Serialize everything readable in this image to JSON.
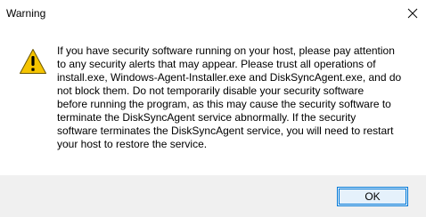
{
  "window": {
    "title": "Warning"
  },
  "titlebar": {
    "close_icon": "close-icon"
  },
  "message": {
    "icon": "warning-icon",
    "lines": [
      "If you have security software running on your host, please pay attention",
      "to any security alerts that may appear. Please trust all operations of",
      "install.exe, Windows-Agent-Installer.exe and DiskSyncAgent.exe, and do",
      "not block them. Do not temporarily disable your security software",
      "before running the program, as this may cause the security software to",
      "terminate the DiskSyncAgent service abnormally. If the security",
      "software terminates the DiskSyncAgent service, you will need to restart",
      "your host to restore the service."
    ]
  },
  "footer": {
    "ok_label": "OK"
  },
  "colors": {
    "footer_bg": "#f0f0f0",
    "button_border": "#0078d7",
    "button_bg": "#e5f1fb",
    "warning_yellow": "#f5c400"
  }
}
